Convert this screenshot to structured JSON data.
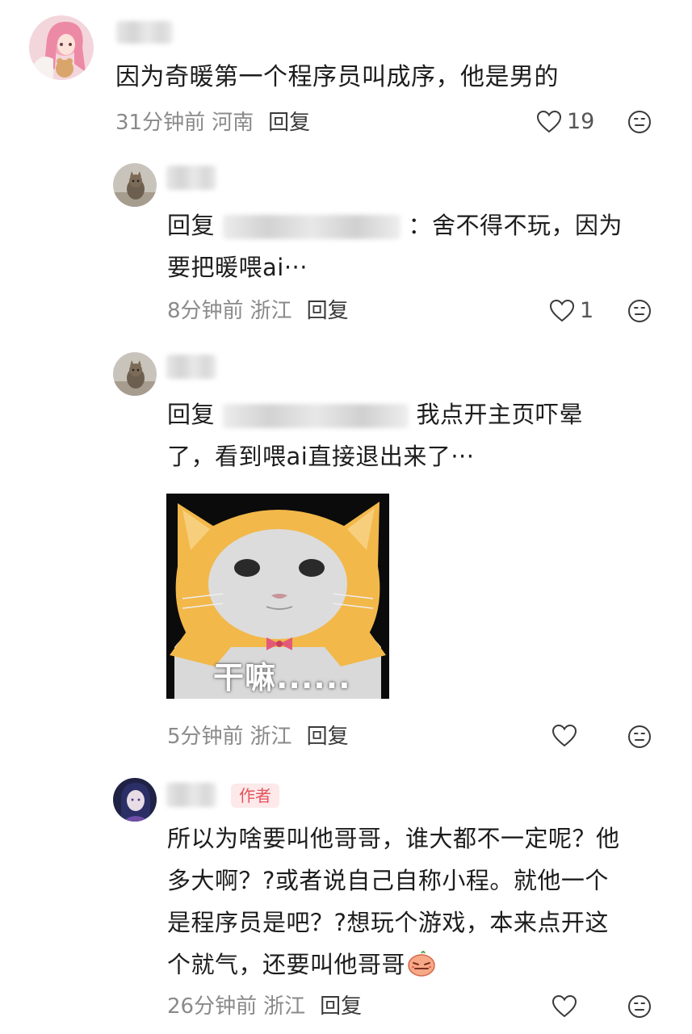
{
  "comments": [
    {
      "text": "因为奇暖第一个程序员叫成序，他是男的",
      "time": "31分钟前",
      "location": "河南",
      "reply_label": "回复",
      "likes": "19"
    },
    {
      "reply_prefix": "回复",
      "text_line1": "：舍不得不玩，因为",
      "text_line2": "要把暖喂ai···",
      "time": "8分钟前",
      "location": "浙江",
      "reply_label": "回复",
      "likes": "1"
    },
    {
      "reply_prefix": "回复",
      "text_line1": "我点开主页吓晕",
      "text_line2": "了，看到喂ai直接退出来了···",
      "sticker_caption": "干嘛......",
      "time": "5分钟前",
      "location": "浙江",
      "reply_label": "回复"
    },
    {
      "badge": "作者",
      "text_line1": "所以为啥要叫他哥哥，谁大都不一定呢？他",
      "text_line2": "多大啊？?或者说自己自称小程。就他一个",
      "text_line3": "是程序员是吧？?想玩个游戏，本来点开这",
      "text_line4": "个就气，还要叫他哥哥",
      "time": "26分钟前",
      "location": "浙江",
      "reply_label": "回复"
    }
  ],
  "icons": {
    "like": "heart-outline-icon",
    "dislike": "neutral-face-icon",
    "emoji": "flushed-face-emoji"
  },
  "colors": {
    "meta_text": "#8a8a8a",
    "author_badge_bg": "#fde9ea",
    "author_badge_text": "#e5535c"
  }
}
